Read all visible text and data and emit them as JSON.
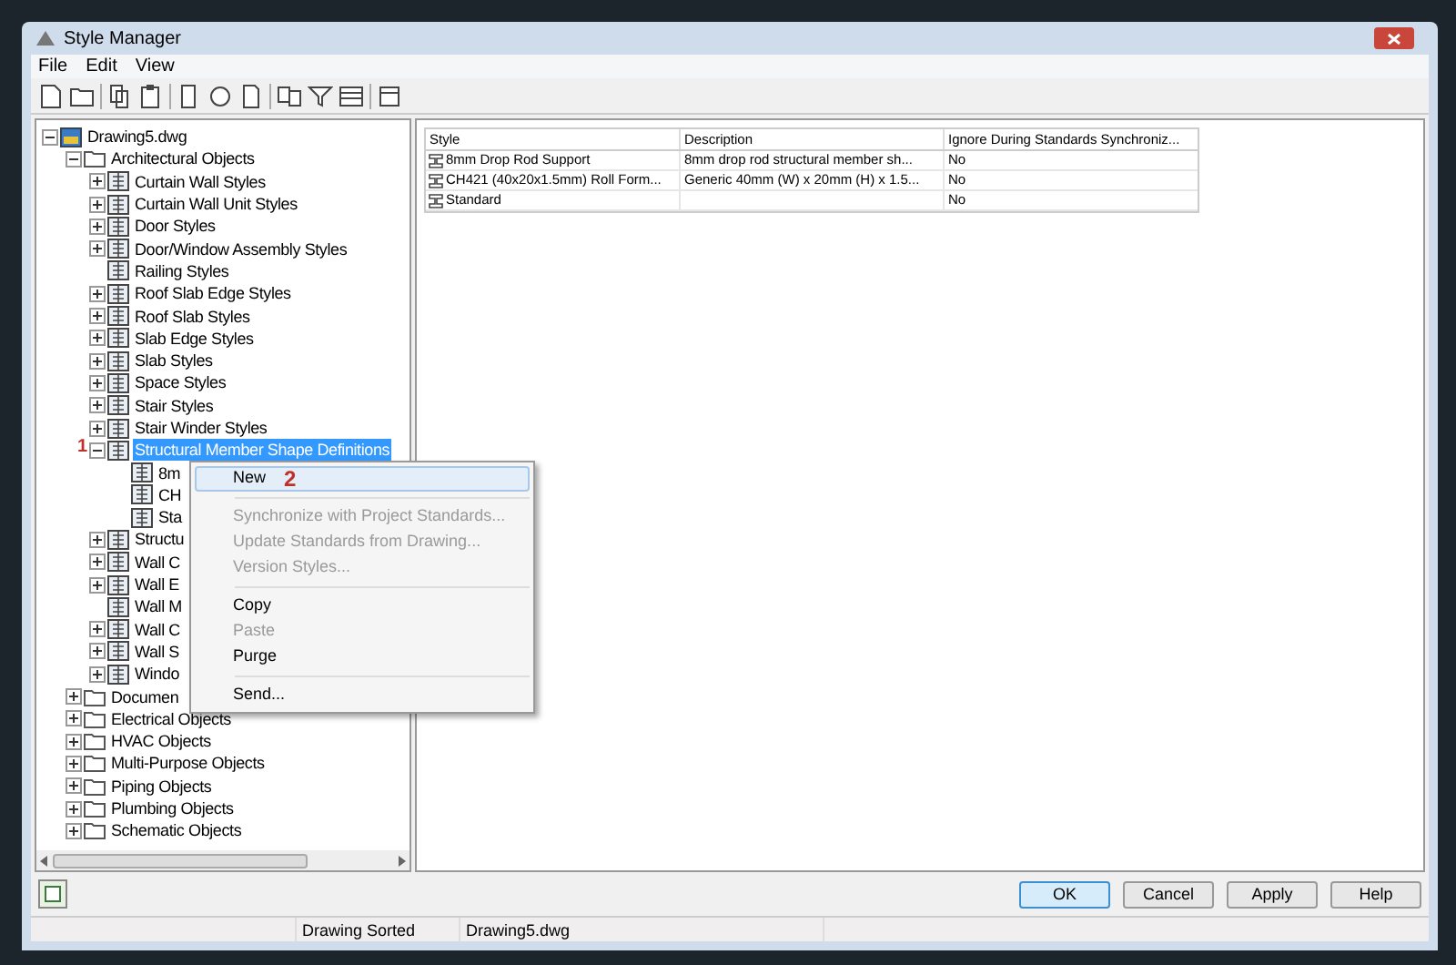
{
  "window": {
    "title": "Style Manager"
  },
  "menu": [
    "File",
    "Edit",
    "View"
  ],
  "tree": [
    {
      "label": "Drawing5.dwg",
      "kind": "drawing",
      "expanded": true,
      "selected": false,
      "children": [
        {
          "label": "Architectural Objects",
          "kind": "folder",
          "expanded": true,
          "selected": false,
          "children": [
            {
              "label": "Curtain Wall Styles",
              "kind": "style",
              "expanded": false,
              "selected": false
            },
            {
              "label": "Curtain Wall Unit Styles",
              "kind": "style",
              "expanded": false,
              "selected": false
            },
            {
              "label": "Door Styles",
              "kind": "style",
              "expanded": false,
              "selected": false
            },
            {
              "label": "Door/Window Assembly Styles",
              "kind": "style",
              "expanded": false,
              "selected": false
            },
            {
              "label": "Railing Styles",
              "kind": "style",
              "selected": false
            },
            {
              "label": "Roof Slab Edge Styles",
              "kind": "style",
              "expanded": false,
              "selected": false
            },
            {
              "label": "Roof Slab Styles",
              "kind": "style",
              "expanded": false,
              "selected": false
            },
            {
              "label": "Slab Edge Styles",
              "kind": "style",
              "expanded": false,
              "selected": false
            },
            {
              "label": "Slab Styles",
              "kind": "style",
              "expanded": false,
              "selected": false
            },
            {
              "label": "Space Styles",
              "kind": "style",
              "expanded": false,
              "selected": false
            },
            {
              "label": "Stair Styles",
              "kind": "style",
              "expanded": false,
              "selected": false
            },
            {
              "label": "Stair Winder Styles",
              "kind": "style",
              "expanded": false,
              "selected": false
            },
            {
              "label": "Structural Member Shape Definitions",
              "kind": "style",
              "expanded": true,
              "selected": true,
              "marker": "1",
              "children": [
                {
                  "label": "8m",
                  "kind": "style",
                  "selected": false
                },
                {
                  "label": "CH",
                  "kind": "style",
                  "selected": false
                },
                {
                  "label": "Sta",
                  "kind": "style",
                  "selected": false
                }
              ]
            },
            {
              "label": "Structu",
              "kind": "style",
              "expanded": false,
              "selected": false
            },
            {
              "label": "Wall C",
              "kind": "style",
              "expanded": false,
              "selected": false
            },
            {
              "label": "Wall E",
              "kind": "style",
              "expanded": false,
              "selected": false
            },
            {
              "label": "Wall M",
              "kind": "style",
              "selected": false
            },
            {
              "label": "Wall C",
              "kind": "style",
              "expanded": false,
              "selected": false
            },
            {
              "label": "Wall S",
              "kind": "style",
              "expanded": false,
              "selected": false
            },
            {
              "label": "Windo",
              "kind": "style",
              "expanded": false,
              "selected": false
            }
          ]
        },
        {
          "label": "Documen",
          "kind": "folder",
          "expanded": false,
          "selected": false
        },
        {
          "label": "Electrical Objects",
          "kind": "folder",
          "expanded": false,
          "selected": false
        },
        {
          "label": "HVAC Objects",
          "kind": "folder",
          "expanded": false,
          "selected": false
        },
        {
          "label": "Multi-Purpose Objects",
          "kind": "folder",
          "expanded": false,
          "selected": false
        },
        {
          "label": "Piping Objects",
          "kind": "folder",
          "expanded": false,
          "selected": false
        },
        {
          "label": "Plumbing Objects",
          "kind": "folder",
          "expanded": false,
          "selected": false
        },
        {
          "label": "Schematic Objects",
          "kind": "folder",
          "expanded": false,
          "selected": false
        }
      ]
    }
  ],
  "context_menu": [
    {
      "kind": "item",
      "label": "New",
      "disabled": false,
      "selected": true,
      "marker": "2"
    },
    {
      "kind": "separator"
    },
    {
      "kind": "item",
      "label": "Synchronize with Project Standards...",
      "disabled": true,
      "selected": false
    },
    {
      "kind": "item",
      "label": "Update Standards from Drawing...",
      "disabled": true,
      "selected": false
    },
    {
      "kind": "item",
      "label": "Version Styles...",
      "disabled": true,
      "selected": false
    },
    {
      "kind": "separator"
    },
    {
      "kind": "item",
      "label": "Copy",
      "disabled": false,
      "selected": false
    },
    {
      "kind": "item",
      "label": "Paste",
      "disabled": true,
      "selected": false
    },
    {
      "kind": "item",
      "label": "Purge",
      "disabled": false,
      "selected": false
    },
    {
      "kind": "separator"
    },
    {
      "kind": "item",
      "label": "Send...",
      "disabled": false,
      "selected": false
    }
  ],
  "table": {
    "columns": [
      "Style",
      "Description",
      "Ignore During Standards Synchroniz..."
    ],
    "rows": [
      [
        "8mm Drop Rod Support",
        "8mm drop rod structural member sh...",
        "No"
      ],
      [
        "CH421 (40x20x1.5mm) Roll Form...",
        "Generic 40mm (W) x 20mm (H) x 1.5...",
        "No"
      ],
      [
        "Standard",
        "",
        "No"
      ]
    ]
  },
  "buttons": [
    {
      "label": "OK",
      "default": true
    },
    {
      "label": "Cancel",
      "default": false
    },
    {
      "label": "Apply",
      "default": false
    },
    {
      "label": "Help",
      "default": false
    }
  ],
  "status_bar": [
    "Drawing Sorted",
    "Drawing5.dwg"
  ]
}
